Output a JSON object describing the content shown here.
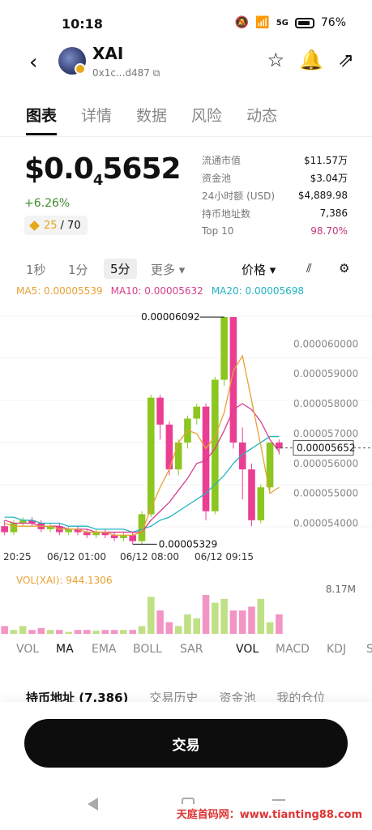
{
  "status": {
    "time": "10:18",
    "battery": "76%",
    "network": "5G"
  },
  "header": {
    "name": "XAI",
    "address": "0x1c...d487"
  },
  "tabs": [
    "图表",
    "详情",
    "数据",
    "风险",
    "动态"
  ],
  "price": {
    "main": "$0.0",
    "sub": "4",
    "rest": "5652",
    "change": "+6.26%",
    "score": "25",
    "score_total": "/ 70"
  },
  "stats": [
    {
      "label": "流通市值",
      "value": "$11.57万"
    },
    {
      "label": "资金池",
      "value": "$3.04万"
    },
    {
      "label": "24小时额 (USD)",
      "value": "$4,889.98"
    },
    {
      "label": "持币地址数",
      "value": "7,386"
    },
    {
      "label": "Top 10",
      "value": "98.70%"
    }
  ],
  "intervals": [
    "1秒",
    "1分",
    "5分",
    "更多 ▾"
  ],
  "chart_toolbar": {
    "type_select": "价格 ▾"
  },
  "ma": {
    "ma5": "MA5: 0.00005539",
    "ma10": "MA10: 0.00005632",
    "ma20": "MA20: 0.00005698"
  },
  "chart_data": {
    "type": "candlestick",
    "y_ticks": [
      "0.000060000",
      "0.000059000",
      "0.000058000",
      "0.000057000",
      "0.000056000",
      "0.000055000",
      "0.000054000"
    ],
    "ylim": [
      5.32e-05,
      6.12e-05
    ],
    "current_price": "0.00005652",
    "high_label": "0.00006092",
    "low_label": "0.00005329",
    "x_labels": [
      "20:25",
      "06/12 01:00",
      "06/12 08:00",
      "06/12 09:15"
    ],
    "candles": [
      [
        5.39e-05,
        5.37e-05,
        5.41e-05,
        5.36e-05
      ],
      [
        5.37e-05,
        5.4e-05,
        5.41e-05,
        5.36e-05
      ],
      [
        5.4e-05,
        5.41e-05,
        5.42e-05,
        5.39e-05
      ],
      [
        5.41e-05,
        5.4e-05,
        5.42e-05,
        5.39e-05
      ],
      [
        5.4e-05,
        5.38e-05,
        5.41e-05,
        5.37e-05
      ],
      [
        5.38e-05,
        5.39e-05,
        5.4e-05,
        5.37e-05
      ],
      [
        5.39e-05,
        5.37e-05,
        5.4e-05,
        5.36e-05
      ],
      [
        5.37e-05,
        5.38e-05,
        5.39e-05,
        5.36e-05
      ],
      [
        5.38e-05,
        5.37e-05,
        5.39e-05,
        5.36e-05
      ],
      [
        5.37e-05,
        5.36e-05,
        5.38e-05,
        5.35e-05
      ],
      [
        5.36e-05,
        5.37e-05,
        5.38e-05,
        5.35e-05
      ],
      [
        5.37e-05,
        5.36e-05,
        5.38e-05,
        5.35e-05
      ],
      [
        5.36e-05,
        5.35e-05,
        5.37e-05,
        5.34e-05
      ],
      [
        5.35e-05,
        5.36e-05,
        5.37e-05,
        5.34e-05
      ],
      [
        5.36e-05,
        5.34e-05,
        5.37e-05,
        5.33e-05
      ],
      [
        5.34e-05,
        5.43e-05,
        5.44e-05,
        5.33e-05
      ],
      [
        5.43e-05,
        5.82e-05,
        5.83e-05,
        5.42e-05
      ],
      [
        5.82e-05,
        5.73e-05,
        5.83e-05,
        5.68e-05
      ],
      [
        5.73e-05,
        5.58e-05,
        5.74e-05,
        5.56e-05
      ],
      [
        5.58e-05,
        5.67e-05,
        5.68e-05,
        5.56e-05
      ],
      [
        5.67e-05,
        5.75e-05,
        5.76e-05,
        5.65e-05
      ],
      [
        5.75e-05,
        5.79e-05,
        5.8e-05,
        5.73e-05
      ],
      [
        5.79e-05,
        5.44e-05,
        5.8e-05,
        5.41e-05
      ],
      [
        5.44e-05,
        5.88e-05,
        5.89e-05,
        5.43e-05
      ],
      [
        5.88e-05,
        6.09e-05,
        6.09e-05,
        5.86e-05
      ],
      [
        6.09e-05,
        5.67e-05,
        6.09e-05,
        5.65e-05
      ],
      [
        5.67e-05,
        5.58e-05,
        5.72e-05,
        5.48e-05
      ],
      [
        5.58e-05,
        5.41e-05,
        5.6e-05,
        5.39e-05
      ],
      [
        5.41e-05,
        5.52e-05,
        5.53e-05,
        5.4e-05
      ],
      [
        5.52e-05,
        5.67e-05,
        5.67e-05,
        5.51e-05
      ],
      [
        5.67e-05,
        5.65e-05,
        5.68e-05,
        5.63e-05
      ]
    ],
    "ma5": [
      5.4e-05,
      5.39e-05,
      5.39e-05,
      5.39e-05,
      5.39e-05,
      5.39e-05,
      5.38e-05,
      5.38e-05,
      5.38e-05,
      5.37e-05,
      5.37e-05,
      5.37e-05,
      5.36e-05,
      5.36e-05,
      5.36e-05,
      5.37e-05,
      5.45e-05,
      5.52e-05,
      5.58e-05,
      5.67e-05,
      5.71e-05,
      5.7e-05,
      5.65e-05,
      5.69e-05,
      5.77e-05,
      5.91e-05,
      5.96e-05,
      5.81e-05,
      5.66e-05,
      5.5e-05,
      5.52e-05
    ],
    "ma10": [
      5.41e-05,
      5.4e-05,
      5.4e-05,
      5.4e-05,
      5.39e-05,
      5.39e-05,
      5.39e-05,
      5.38e-05,
      5.38e-05,
      5.38e-05,
      5.37e-05,
      5.37e-05,
      5.37e-05,
      5.37e-05,
      5.37e-05,
      5.37e-05,
      5.41e-05,
      5.44e-05,
      5.47e-05,
      5.51e-05,
      5.55e-05,
      5.6e-05,
      5.61e-05,
      5.65e-05,
      5.71e-05,
      5.78e-05,
      5.8e-05,
      5.78e-05,
      5.74e-05,
      5.68e-05,
      5.64e-05
    ],
    "ma20": [
      5.42e-05,
      5.42e-05,
      5.41e-05,
      5.41e-05,
      5.4e-05,
      5.4e-05,
      5.4e-05,
      5.39e-05,
      5.39e-05,
      5.39e-05,
      5.38e-05,
      5.38e-05,
      5.38e-05,
      5.38e-05,
      5.37e-05,
      5.38e-05,
      5.39e-05,
      5.41e-05,
      5.42e-05,
      5.44e-05,
      5.46e-05,
      5.48e-05,
      5.5e-05,
      5.53e-05,
      5.56e-05,
      5.6e-05,
      5.63e-05,
      5.65e-05,
      5.67e-05,
      5.69e-05,
      5.69e-05
    ],
    "colors": {
      "up": "#8cc620",
      "down": "#ea3e93",
      "ma5": "#e7a232",
      "ma10": "#d53f8c",
      "ma20": "#22b3c0"
    }
  },
  "volume": {
    "label": "VOL(XAI): 944.1306",
    "max_label": "8.17M",
    "values": [
      0.2,
      0.1,
      0.2,
      0.1,
      0.15,
      0.1,
      0.1,
      0.05,
      0.1,
      0.1,
      0.08,
      0.1,
      0.1,
      0.1,
      0.1,
      0.2,
      0.95,
      0.6,
      0.3,
      0.2,
      0.5,
      0.4,
      1.0,
      0.8,
      0.9,
      0.6,
      0.6,
      0.7,
      0.9,
      0.3,
      0.5
    ]
  },
  "indicators": [
    "VOL",
    "MA",
    "EMA",
    "BOLL",
    "SAR",
    "VOL",
    "MACD",
    "KDJ",
    "S"
  ],
  "bottom_tabs": [
    "持币地址 (7,386)",
    "交易历史",
    "资金池",
    "我的仓位"
  ],
  "trade_label": "交易",
  "watermark": "天庭首码网：www.tianting88.com"
}
